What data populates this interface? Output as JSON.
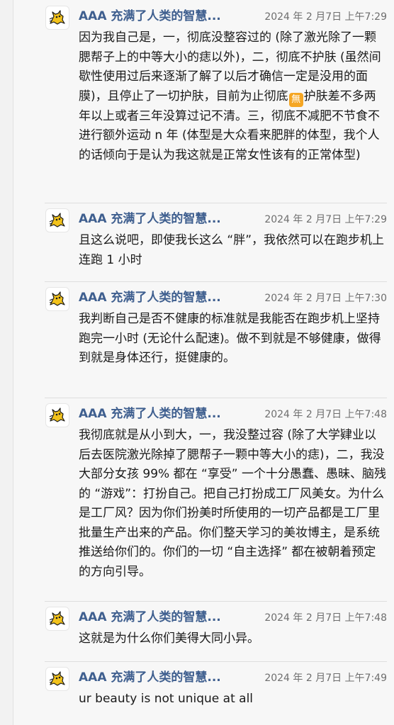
{
  "chat": {
    "messages": [
      {
        "sender": "AAA 充满了人类的智慧...",
        "time": "2024 年 2 月7日 上午7:29",
        "text_before": "因为我自己是，一，彻底没整容过的 (除了激光除了一颗腮帮子上的中等大小的痣以外)，二，彻底不护肤 (虽然间歇性使用过后来逐渐了解了以后才确信一定是没用的面膜)，且停止了一切护肤，目前为止彻底",
        "emoji": "無",
        "text_after": "护肤差不多两年以上或者三年没算过记不清。三，彻底不减肥不节食不进行额外运动 n 年 (体型是大众看来肥胖的体型，我个人的话倾向于是认为我这就是正常女性该有的正常体型)"
      },
      {
        "sender": "AAA 充满了人类的智慧...",
        "time": "2024 年 2 月7日 上午7:29",
        "text": "且这么说吧，即使我长这么 “胖”，我依然可以在跑步机上连跑 1 小时"
      },
      {
        "sender": "AAA 充满了人类的智慧...",
        "time": "2024 年 2 月7日 上午7:30",
        "text": "我判断自己是否不健康的标准就是我能否在跑步机上坚持跑完一小时 (无论什么配速)。做不到就是不够健康，做得到就是身体还行，挺健康的。"
      },
      {
        "sender": "AAA 充满了人类的智慧...",
        "time": "2024 年 2 月7日 上午7:48",
        "text": "我彻底就是从小到大，一，我没整过容 (除了大学肄业以后去医院激光除掉了腮帮子一颗中等大小的痣)，二，我没大部分女孩 99% 都在 “享受” 一个十分愚蠢、愚昧、脑残的 “游戏”：打扮自己。把自己打扮成工厂风美女。为什么是工厂风？因为你们扮美时所使用的一切产品都是工厂里批量生产出来的产品。你们整天学习的美妆博主，是系统推送给你们的。你们的一切 “自主选择” 都在被朝着预定的方向引导。"
      },
      {
        "sender": "AAA 充满了人类的智慧...",
        "time": "2024 年 2 月7日 上午7:48",
        "text": "这就是为什么你们美得大同小异。"
      },
      {
        "sender": "AAA 充满了人类的智慧...",
        "time": "2024 年 2 月7日 上午7:49",
        "text": "ur beauty is not unique at all"
      }
    ],
    "avatar_icon": "yellow-cat-icon",
    "colors": {
      "sender": "#3f5f8f",
      "time": "#6e6e6e",
      "text": "#1a1a1a",
      "background": "#f7f7f7",
      "emoji_badge": "#f5a623"
    }
  }
}
